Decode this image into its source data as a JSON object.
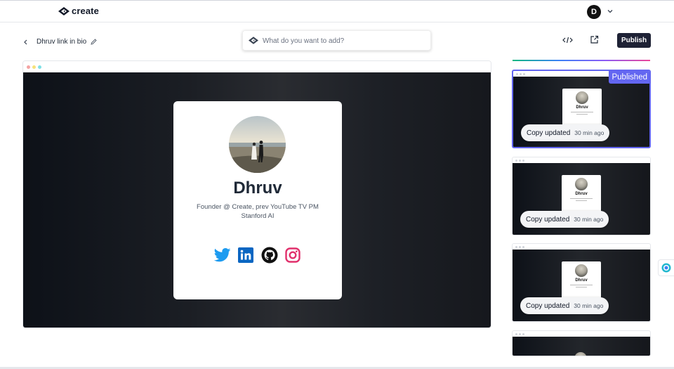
{
  "app": {
    "logo_text": "create",
    "user_initial": "D"
  },
  "toolbar": {
    "document_title": "Dhruv link in bio",
    "prompt_placeholder": "What do you want to add?",
    "publish_label": "Publish"
  },
  "preview": {
    "name": "Dhruv",
    "bio_line1": "Founder @ Create, prev YouTube TV PM",
    "bio_line2": "Stanford AI",
    "socials": [
      "twitter-icon",
      "linkedin-icon",
      "github-icon",
      "instagram-icon"
    ]
  },
  "versions": [
    {
      "card_name": "Dhruv",
      "status": "Copy updated",
      "time": "30 min ago",
      "badge": "Published",
      "selected": true
    },
    {
      "card_name": "Dhruv",
      "status": "Copy updated",
      "time": "30 min ago"
    },
    {
      "card_name": "Dhruv",
      "status": "Copy updated",
      "time": "30 min ago"
    },
    {
      "card_name": ""
    }
  ],
  "colors": {
    "accent": "#6366f1",
    "publish_button": "#1e2235",
    "twitter": "#1d9bf0",
    "linkedin": "#0a66c2",
    "github": "#111111",
    "instagram": "#e1306c"
  }
}
